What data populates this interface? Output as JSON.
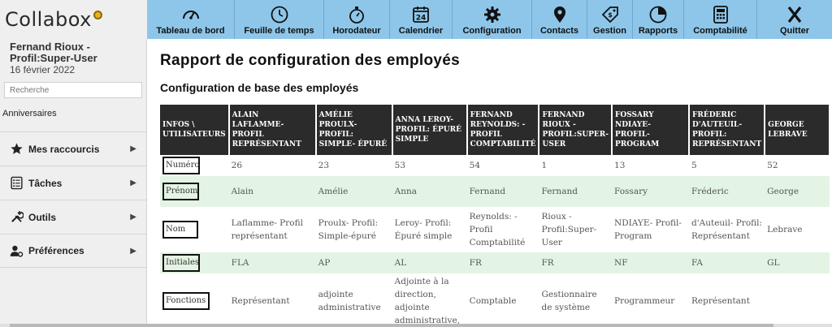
{
  "app": {
    "brand": "Collabox"
  },
  "nav": [
    {
      "label": "Tableau de bord",
      "icon": "gauge-icon"
    },
    {
      "label": "Feuille de temps",
      "icon": "clock-icon"
    },
    {
      "label": "Horodateur",
      "icon": "stopwatch-icon"
    },
    {
      "label": "Calendrier",
      "icon": "calendar-icon"
    },
    {
      "label": "Configuration",
      "icon": "gear-icon"
    },
    {
      "label": "Contacts",
      "icon": "map-pin-icon"
    },
    {
      "label": "Gestion",
      "icon": "price-tag-icon"
    },
    {
      "label": "Rapports",
      "icon": "pie-chart-icon"
    },
    {
      "label": "Comptabilité",
      "icon": "calculator-icon"
    },
    {
      "label": "Quitter",
      "icon": "x-icon"
    }
  ],
  "sidebar": {
    "user_name": "Fernand Rioux - Profil:Super-User",
    "date": "16 février 2022",
    "search_placeholder": "Recherche",
    "anniversaries": "Anniversaires",
    "menu": [
      {
        "label": "Mes raccourcis",
        "icon": "star-icon"
      },
      {
        "label": "Tâches",
        "icon": "task-list-icon"
      },
      {
        "label": "Outils",
        "icon": "tools-icon"
      },
      {
        "label": "Préférences",
        "icon": "user-settings-icon"
      }
    ]
  },
  "main": {
    "title": "Rapport de configuration des employés",
    "subtitle": "Configuration de base des employés",
    "table": {
      "headers": [
        "INFOS \\ UTILISATEURS",
        "ALAIN LAFLAMME- PROFIL REPRÉSENTANT",
        "AMÉLIE PROULX- PROFIL: SIMPLE- ÉPURÉ",
        "ANNA LEROY- PROFIL: ÉPURÉ SIMPLE",
        "FERNAND REYNOLDS: - PROFIL COMPTABILITÉ",
        "FERNAND RIOUX - PROFIL:SUPER- USER",
        "FOSSARY NDIAYE- PROFIL- PROGRAM",
        "FRÉDERIC D'AUTEUIL- PROFIL: REPRÉSENTANT",
        "GEORGE LEBRAVE"
      ],
      "rows": [
        {
          "label": "Numéro",
          "cells": [
            "26",
            "23",
            "53",
            "54",
            "1",
            "13",
            "5",
            "52"
          ]
        },
        {
          "label": "Prénom",
          "cells": [
            "Alain",
            "Amélie",
            "Anna",
            "Fernand",
            "Fernand",
            "Fossary",
            "Fréderic",
            "George"
          ]
        },
        {
          "label": "Nom",
          "cells": [
            "Laflamme- Profil représentant",
            "Proulx- Profil: Simple-épuré",
            "Leroy- Profil: Épuré simple",
            "Reynolds: - Profil Comptabilité",
            "Rioux - Profil:Super-User",
            "NDIAYE- Profil-Program",
            "d'Auteuil- Profil: Représentant",
            "Lebrave"
          ]
        },
        {
          "label": "Initiales",
          "cells": [
            "FLA",
            "AP",
            "AL",
            "FR",
            "FR",
            "NF",
            "FA",
            "GL"
          ]
        },
        {
          "label": "Fonctions",
          "cells": [
            "Représentant",
            "adjointe administrative",
            "Adjointe à la direction, adjointe administrative,",
            "Comptable",
            "Gestionnaire de système",
            "Programmeur",
            "Représentant",
            ""
          ]
        }
      ]
    }
  }
}
